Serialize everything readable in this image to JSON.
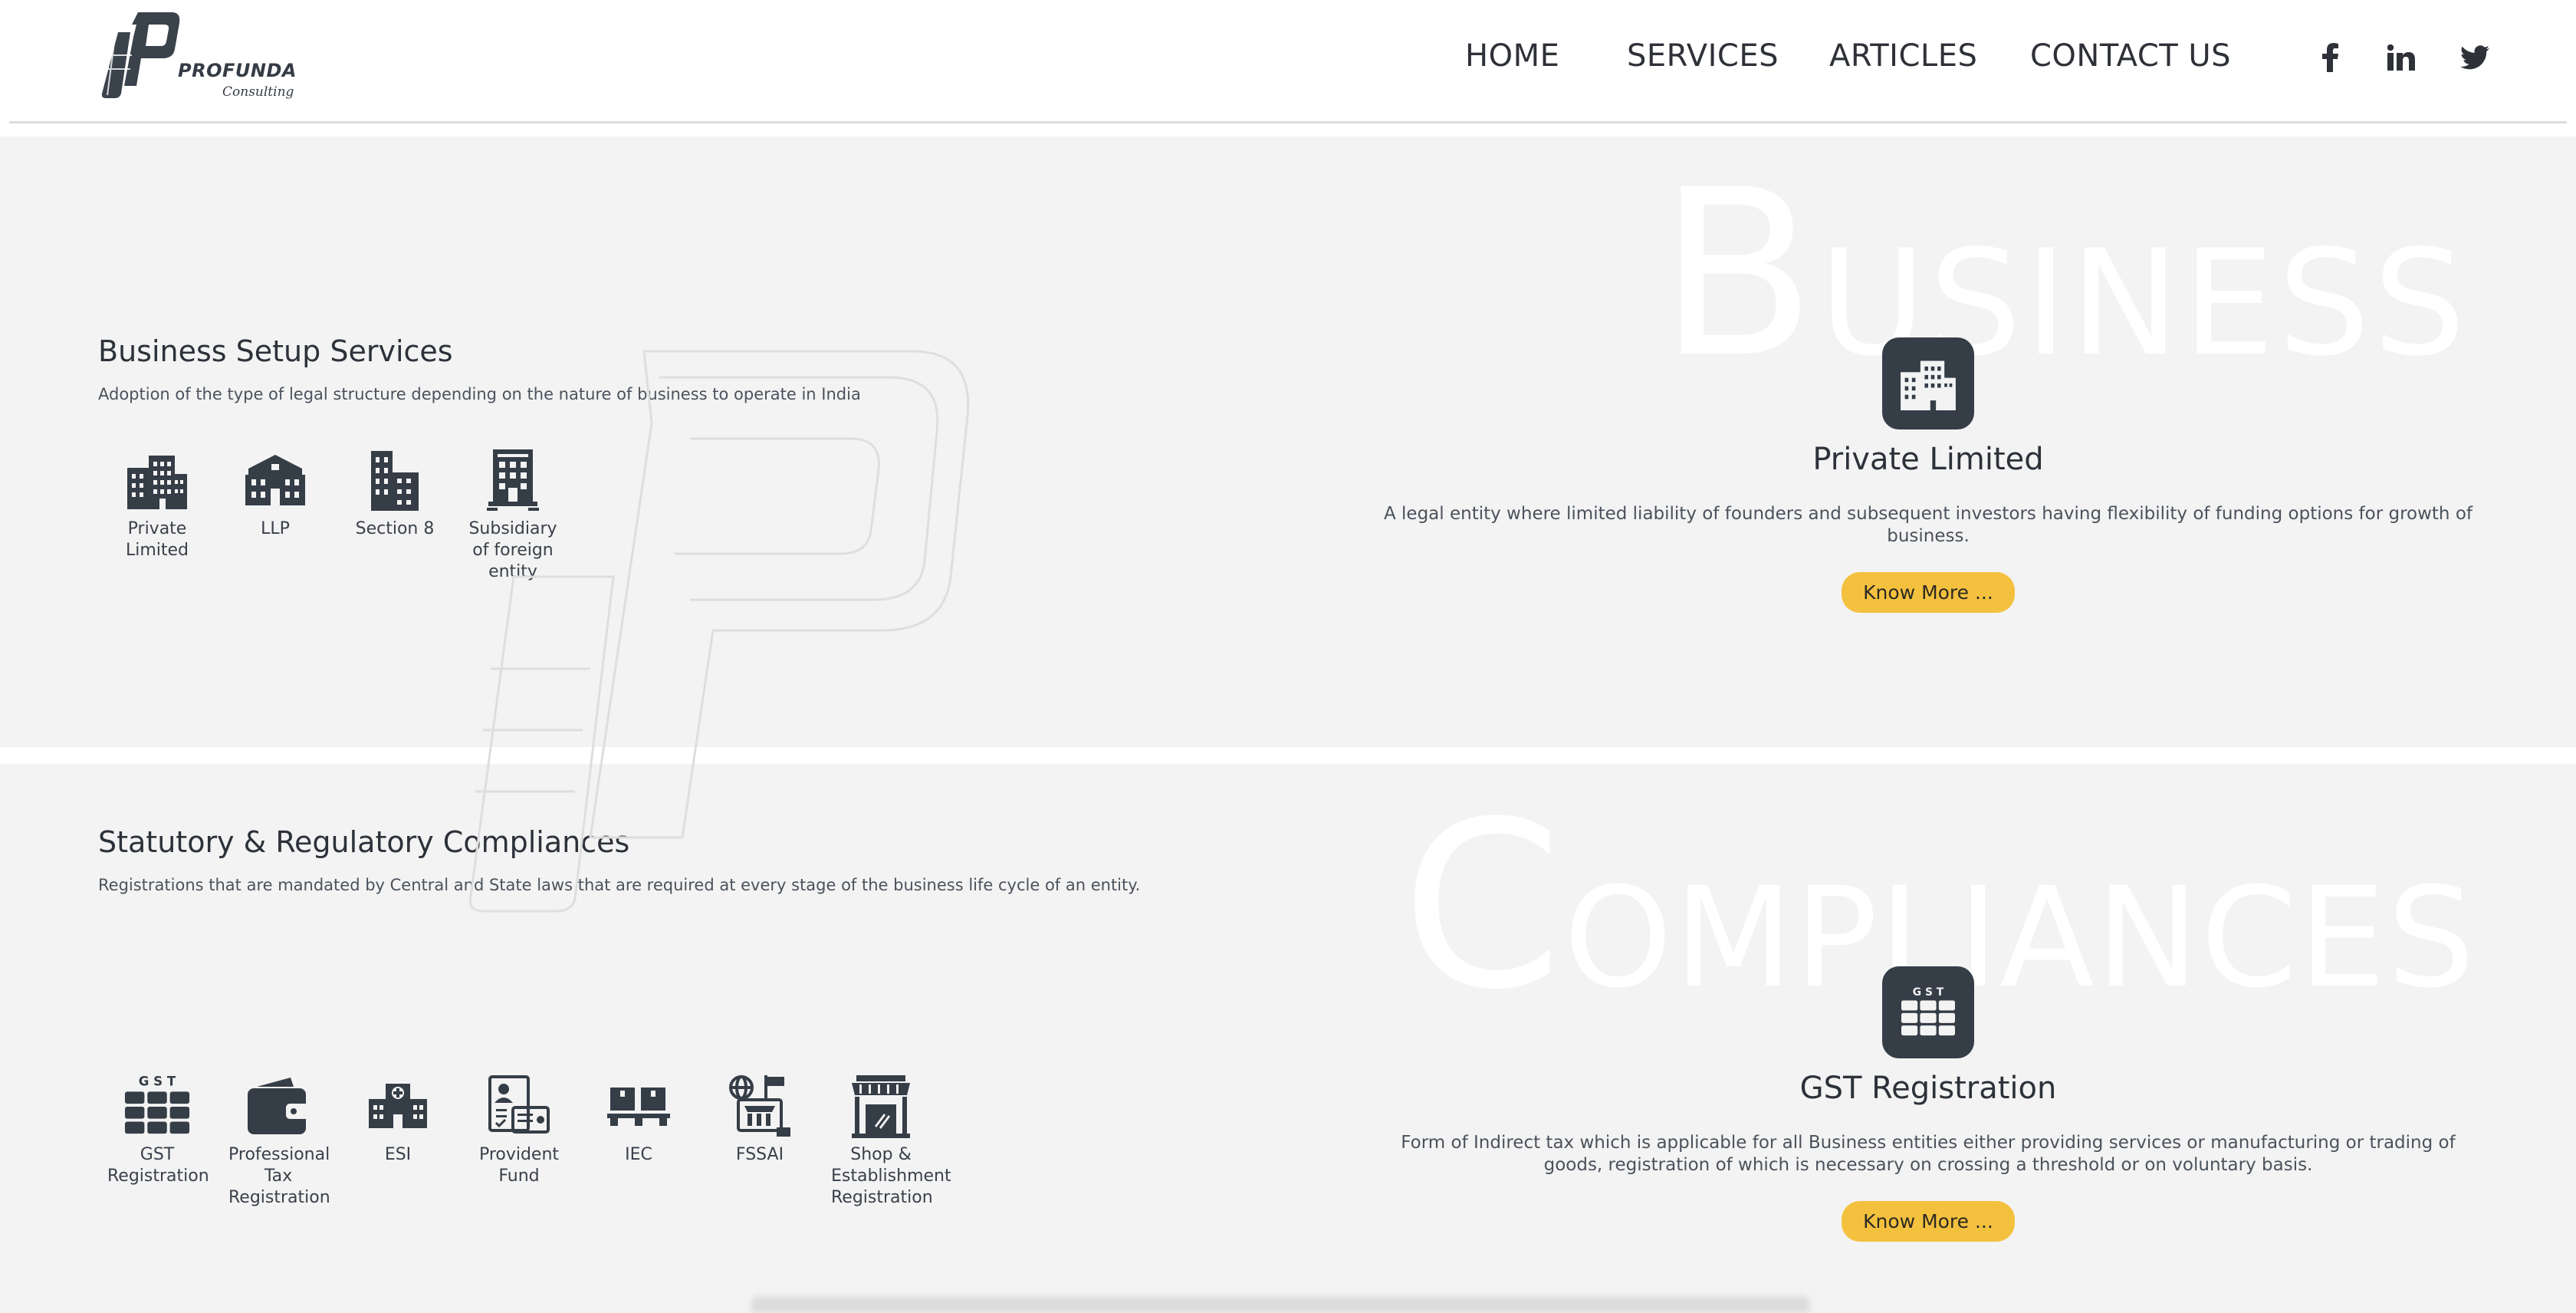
{
  "brand": {
    "name": "PROFUNDA",
    "tagline": "Consulting"
  },
  "nav": {
    "home": "HOME",
    "services": "SERVICES",
    "articles": "ARTICLES",
    "contact": "CONTACT US"
  },
  "social": [
    "facebook-icon",
    "linkedin-icon",
    "twitter-icon"
  ],
  "colors": {
    "accent": "#f4c13f",
    "icon_dark": "#353d47",
    "section_bg": "#f3f3f3"
  },
  "business": {
    "watermark_cap": "B",
    "watermark_rest": "usiness",
    "title": "Business Setup Services",
    "description": "Adoption of the type of legal structure depending on the nature of business to operate in India",
    "items": [
      "Private Limited",
      "LLP",
      "Section 8",
      "Subsidiary of foreign entity"
    ],
    "detail": {
      "title": "Private Limited",
      "description": "A legal entity where limited liability of founders and subsequent investors having flexibility of funding options for growth of business.",
      "button": "Know More ..."
    }
  },
  "compliances": {
    "watermark_cap": "C",
    "watermark_rest": "ompliances",
    "title": "Statutory & Regulatory Compliances",
    "description": "Registrations that are mandated by Central and State laws that are required at every stage of the business life cycle of an entity.",
    "gst_icon_text": "G S T",
    "items": [
      "GST Registration",
      "Professional Tax Registration",
      "ESI",
      "Provident Fund",
      "IEC",
      "FSSAI",
      "Shop & Establishment Registration"
    ],
    "detail": {
      "title": "GST Registration",
      "description": "Form of Indirect tax which is applicable for all Business entities either providing services or manufacturing or trading of goods, registration of which is necessary on crossing a threshold or on voluntary basis.",
      "button": "Know More ..."
    }
  }
}
